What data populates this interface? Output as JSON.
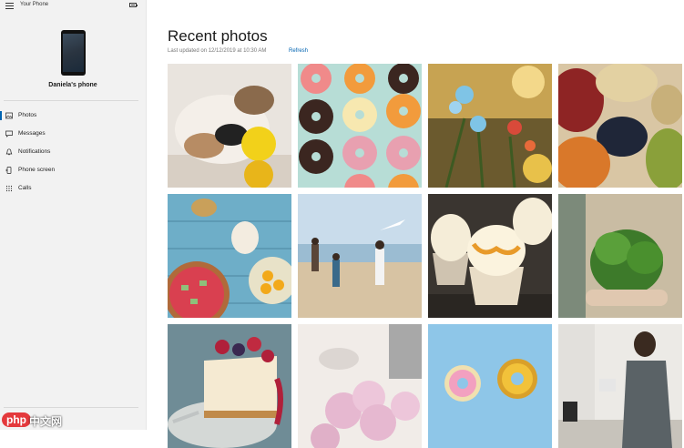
{
  "app": {
    "title": "Your Phone",
    "phone_name": "Daniela's phone"
  },
  "sidebar": {
    "items": [
      {
        "label": "Photos",
        "icon": "photos-icon",
        "active": true
      },
      {
        "label": "Messages",
        "icon": "messages-icon",
        "active": false
      },
      {
        "label": "Notifications",
        "icon": "notifications-icon",
        "active": false
      },
      {
        "label": "Phone screen",
        "icon": "phone-screen-icon",
        "active": false
      },
      {
        "label": "Calls",
        "icon": "calls-icon",
        "active": false
      }
    ]
  },
  "main": {
    "title": "Recent photos",
    "last_updated": "Last updated on 12/12/2019 at 10:30 AM",
    "refresh_label": "Refresh"
  },
  "watermark": {
    "logo_text": "php",
    "site_text": "中文网"
  },
  "colors": {
    "accent": "#0063b1",
    "sidebar_bg": "#f2f2f2"
  }
}
